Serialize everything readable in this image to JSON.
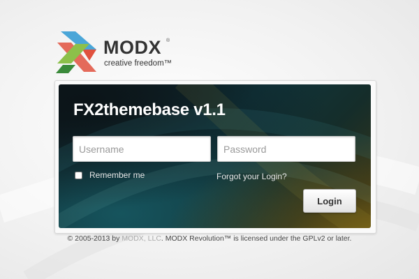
{
  "logo": {
    "wordmark": "MODX",
    "registered": "®",
    "tagline": "creative freedom™",
    "colors": {
      "blue": "#4aa6d8",
      "red": "#e0513e",
      "green": "#8cc04a",
      "darkgreen": "#3a8a3a"
    }
  },
  "login": {
    "title": "FX2themebase v1.1",
    "username_placeholder": "Username",
    "password_placeholder": "Password",
    "remember_label": "Remember me",
    "remember_checked": false,
    "forgot_label": "Forgot your Login?",
    "login_button": "Login"
  },
  "footer": {
    "prefix": "© 2005-2013 by ",
    "company_link": "MODX, LLC",
    "suffix": ". MODX Revolution™ is licensed under the GPLv2 or later."
  }
}
